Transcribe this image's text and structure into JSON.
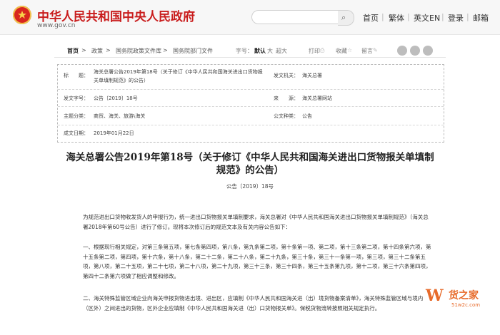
{
  "header": {
    "site_name": "中华人民共和国中央人民政府",
    "domain": "www.gov.cn",
    "nav": [
      "首页",
      "繁体",
      "英文EN",
      "登录",
      "邮箱"
    ],
    "search_icon": "search-icon"
  },
  "breadcrumb": {
    "items": [
      "首页",
      ">",
      "政策",
      ">",
      "国务院政策文件库",
      ">",
      "国务院部门文件"
    ],
    "font_size_label": "字号：",
    "font_sizes": [
      "默认",
      "大",
      "超大"
    ],
    "tools": [
      "打印",
      "收藏",
      "留言"
    ]
  },
  "meta": {
    "title_key": "标　　题：",
    "title_value_line1": "海关总署公告2019年第18号（关于修订《中华人民共和国海关进出口货物报",
    "title_value_line2": "关单填制规范》的公告）",
    "issuer_key": "发文机关：",
    "issuer_value": "海关总署",
    "docno_key": "发文字号：",
    "docno_value": "公告〔2019〕18号",
    "source_key": "来　　源：",
    "source_value": "海关总署网站",
    "topic_key": "主题分类：",
    "topic_value": "商贸、海关、旅游\\海关",
    "type_key": "公文种类：",
    "type_value": "公告",
    "date_key": "成文日期：",
    "date_value": "2019年01月22日"
  },
  "article": {
    "title_line1": "海关总署公告2019年第18号（关于修订《中华人民共和国海关进出口货物报关单填制",
    "title_line2": "规范》的公告）",
    "doc_number": "公告〔2019〕18号",
    "p1": "为规范进出口货物收发货人的申报行为，统一进出口货物报关单填制要求，海关总署对《中华人民共和国海关进出口货物报关单填制规范》（海关总署2018年第60号公告）进行了修订。现将本次修订后的规范文本及有关内容公告如下：",
    "p2": "一、根据现行相关规定，对第三条第五项，第七条第四项，第八条，第九条第二项，第十条第一项、第二项，第十三条第二项，第十四条第六项，第十五条第二项，第四项，第十六条，第十八条，第二十二条，第二十八条，第二十九条，第三十条，第三十一条第一项，第三项，第三十二条第五项，第八项，第二十五项，第二十七项，第二十八项，第二十九项，第三十三条，第三十四条，第三十五条第九项，第十二项，第三十六条第四项，第四十二条第六项做了相应调整和修改。",
    "p3": "二、海关特殊监管区域企业向海关申报货物进出境、进出区，应填制《中华人民共和国海关进（出）境货物备案清单》，海关特殊监管区域与境内（区外）之间进出的货物，区外企业应填制《中华人民共和国海关进（出）口货物报关单》。保税货物流转按照相关规定执行。"
  },
  "watermark": {
    "logo": "W",
    "text": "货之家",
    "url": "51w2c.com"
  }
}
